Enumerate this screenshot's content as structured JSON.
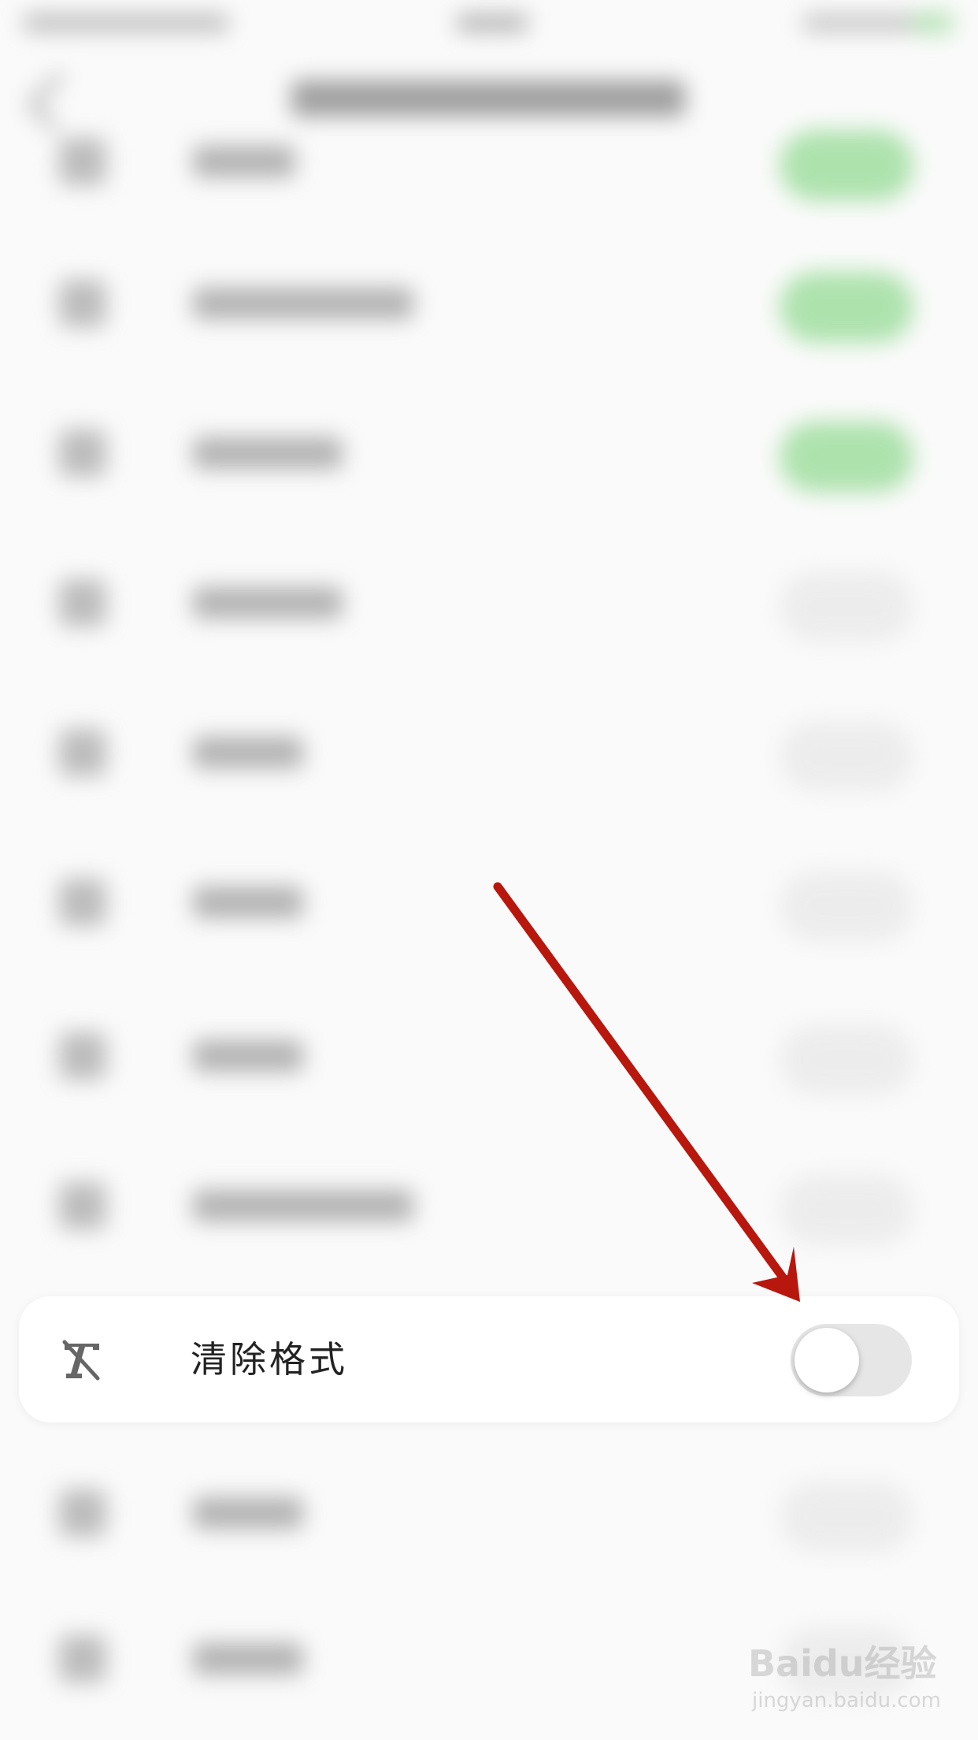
{
  "card": {
    "icon": "clear-format-icon",
    "label": "清除格式",
    "toggle_on": false
  },
  "background_rows": [
    {
      "toggle_on": true
    },
    {
      "toggle_on": true
    },
    {
      "toggle_on": true
    },
    {
      "toggle_on": false
    },
    {
      "toggle_on": false
    },
    {
      "toggle_on": false
    },
    {
      "toggle_on": false
    },
    {
      "toggle_on": false
    },
    {
      "toggle_on": false
    },
    {
      "toggle_on": false
    }
  ],
  "annotation": {
    "arrow_color": "#b8170d"
  },
  "watermark": {
    "brand": "Baidu经验",
    "url": "jingyan.baidu.com"
  },
  "colors": {
    "toggle_on": "#6fcf6f",
    "toggle_off": "#e6e6e6"
  }
}
